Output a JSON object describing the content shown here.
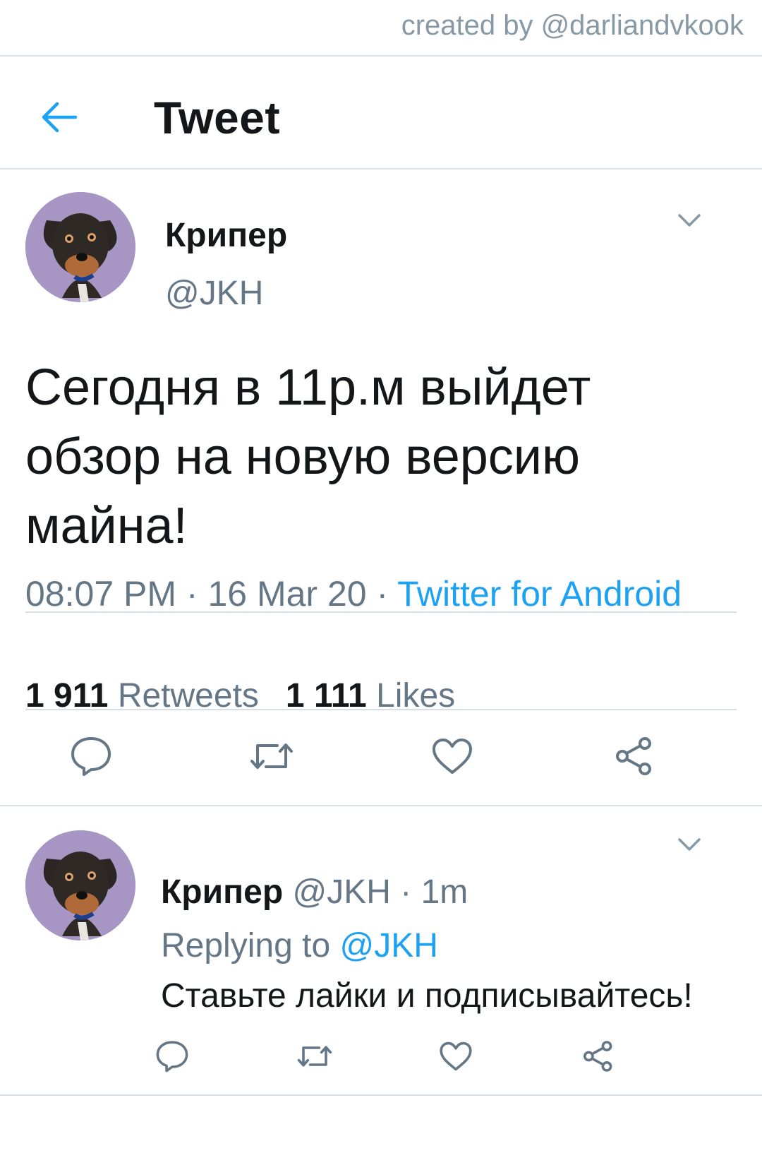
{
  "credit": "created by @darliandvkook",
  "header": {
    "title": "Tweet"
  },
  "tweet": {
    "author_name": "Крипер",
    "author_handle": "@JKH",
    "text": "Сегодня в 11р.м выйдет обзор на новую версию майна!",
    "time": "08:07 PM",
    "date": "16 Mar 20",
    "source": "Twitter for Android",
    "retweets_count": "1 911",
    "retweets_label": "Retweets",
    "likes_count": "1 111",
    "likes_label": "Likes"
  },
  "reply": {
    "author_name": "Крипер",
    "author_handle": "@JKH",
    "age": "1m",
    "replying_prefix": "Replying to",
    "replying_to": "@JKH",
    "text": "Ставьте лайки и подписывайтесь!"
  },
  "icons": {
    "back": "arrow-left-icon",
    "more": "chevron-down-icon",
    "reply": "speech-bubble-icon",
    "retweet": "retweet-icon",
    "like": "heart-icon",
    "share": "share-icon"
  },
  "colors": {
    "accent": "#1da1f2",
    "secondary_text": "#657786",
    "primary_text": "#14171a",
    "divider": "#d9dee2",
    "icon": "#657786"
  }
}
